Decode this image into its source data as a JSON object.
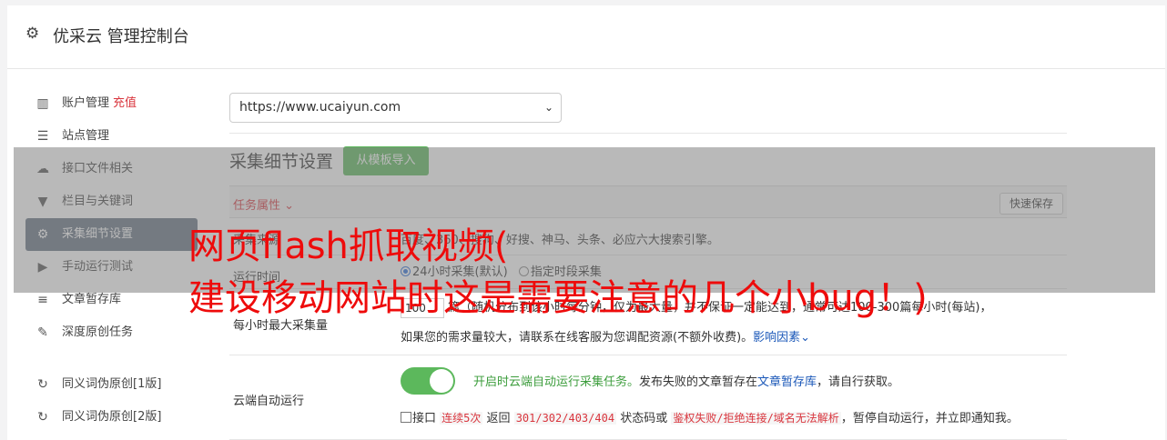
{
  "header": {
    "title": "优采云 管理控制台",
    "icon": "gear-icon"
  },
  "sidebar": {
    "items": [
      {
        "label": "账户管理",
        "extra": "充值",
        "icon": "bar-chart-icon",
        "active": false
      },
      {
        "label": "站点管理",
        "icon": "server-icon",
        "active": false
      },
      {
        "label": "接口文件相关",
        "icon": "cloud-upload-icon",
        "active": false
      },
      {
        "label": "栏目与关键词",
        "icon": "filter-icon",
        "active": false
      },
      {
        "label": "采集细节设置",
        "icon": "gears-icon",
        "active": true
      },
      {
        "label": "手动运行测试",
        "icon": "play-circle-icon",
        "active": false
      },
      {
        "label": "文章暂存库",
        "icon": "database-icon",
        "active": false
      },
      {
        "label": "深度原创任务",
        "icon": "edit-icon",
        "active": false
      },
      {
        "label": "同义词伪原创[1版]",
        "icon": "refresh-icon",
        "active": false
      },
      {
        "label": "同义词伪原创[2版]",
        "icon": "refresh-icon",
        "active": false
      }
    ]
  },
  "main": {
    "site_select_value": "https://www.ucaiyun.com",
    "section_title": "采集细节设置",
    "import_button": "从模板导入",
    "task_tab": "任务属性",
    "save_button": "快速保存",
    "rows": {
      "source_label": "采集来源",
      "source_text": "百度、360、搜狗、好搜、神马、头条、必应六大搜索引擎。",
      "runtime_label": "运行时间",
      "runtime_opt1": "24小时采集(默认)",
      "runtime_opt2": "指定时段采集",
      "max_label": "每小时最大采集量",
      "max_value": "100",
      "max_text_a": "篇（随机分布到该小时每分钟，仅为最大量，并不保证一定能达到，通常可达100-300篇每小时(每站)，",
      "max_text_b": "如果您的需求量较大，请联系在线客服为您调配资源(不额外收费)。",
      "max_link": "影响因素",
      "cloud_label": "云端自动运行",
      "cloud_on_text": "开启时云端自动运行采集任务。",
      "cloud_text_b": "发布失败的文章暂存在",
      "cloud_link": "文章暂存库",
      "cloud_text_c": "，请自行获取。",
      "cb_a": "接口",
      "cb_code1": "连续5次",
      "cb_b": "返回",
      "cb_code2": "301/302/403/404",
      "cb_c": "状态码或",
      "cb_code3": "鉴权失败/拒绝连接/域名无法解析",
      "cb_d": "，暂停自动运行，并立即通知我。"
    }
  },
  "watermark": {
    "line1": "网页flash抓取视频(",
    "line2": "建设移动网站时这是需要注意的几个小bug！)"
  },
  "colors": {
    "accent_green": "#5cb85c",
    "active_sidebar": "#667384",
    "red": "#d9363e",
    "link": "#1a57b8"
  }
}
